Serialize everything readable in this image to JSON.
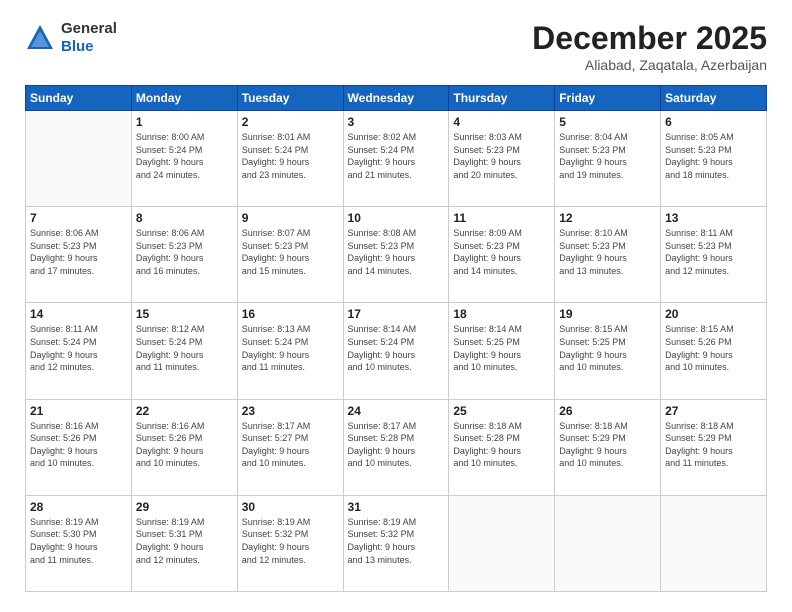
{
  "logo": {
    "general": "General",
    "blue": "Blue"
  },
  "header": {
    "month": "December 2025",
    "location": "Aliabad, Zaqatala, Azerbaijan"
  },
  "weekdays": [
    "Sunday",
    "Monday",
    "Tuesday",
    "Wednesday",
    "Thursday",
    "Friday",
    "Saturday"
  ],
  "weeks": [
    [
      {
        "day": "",
        "info": ""
      },
      {
        "day": "1",
        "info": "Sunrise: 8:00 AM\nSunset: 5:24 PM\nDaylight: 9 hours\nand 24 minutes."
      },
      {
        "day": "2",
        "info": "Sunrise: 8:01 AM\nSunset: 5:24 PM\nDaylight: 9 hours\nand 23 minutes."
      },
      {
        "day": "3",
        "info": "Sunrise: 8:02 AM\nSunset: 5:24 PM\nDaylight: 9 hours\nand 21 minutes."
      },
      {
        "day": "4",
        "info": "Sunrise: 8:03 AM\nSunset: 5:23 PM\nDaylight: 9 hours\nand 20 minutes."
      },
      {
        "day": "5",
        "info": "Sunrise: 8:04 AM\nSunset: 5:23 PM\nDaylight: 9 hours\nand 19 minutes."
      },
      {
        "day": "6",
        "info": "Sunrise: 8:05 AM\nSunset: 5:23 PM\nDaylight: 9 hours\nand 18 minutes."
      }
    ],
    [
      {
        "day": "7",
        "info": "Sunrise: 8:06 AM\nSunset: 5:23 PM\nDaylight: 9 hours\nand 17 minutes."
      },
      {
        "day": "8",
        "info": "Sunrise: 8:06 AM\nSunset: 5:23 PM\nDaylight: 9 hours\nand 16 minutes."
      },
      {
        "day": "9",
        "info": "Sunrise: 8:07 AM\nSunset: 5:23 PM\nDaylight: 9 hours\nand 15 minutes."
      },
      {
        "day": "10",
        "info": "Sunrise: 8:08 AM\nSunset: 5:23 PM\nDaylight: 9 hours\nand 14 minutes."
      },
      {
        "day": "11",
        "info": "Sunrise: 8:09 AM\nSunset: 5:23 PM\nDaylight: 9 hours\nand 14 minutes."
      },
      {
        "day": "12",
        "info": "Sunrise: 8:10 AM\nSunset: 5:23 PM\nDaylight: 9 hours\nand 13 minutes."
      },
      {
        "day": "13",
        "info": "Sunrise: 8:11 AM\nSunset: 5:23 PM\nDaylight: 9 hours\nand 12 minutes."
      }
    ],
    [
      {
        "day": "14",
        "info": "Sunrise: 8:11 AM\nSunset: 5:24 PM\nDaylight: 9 hours\nand 12 minutes."
      },
      {
        "day": "15",
        "info": "Sunrise: 8:12 AM\nSunset: 5:24 PM\nDaylight: 9 hours\nand 11 minutes."
      },
      {
        "day": "16",
        "info": "Sunrise: 8:13 AM\nSunset: 5:24 PM\nDaylight: 9 hours\nand 11 minutes."
      },
      {
        "day": "17",
        "info": "Sunrise: 8:14 AM\nSunset: 5:24 PM\nDaylight: 9 hours\nand 10 minutes."
      },
      {
        "day": "18",
        "info": "Sunrise: 8:14 AM\nSunset: 5:25 PM\nDaylight: 9 hours\nand 10 minutes."
      },
      {
        "day": "19",
        "info": "Sunrise: 8:15 AM\nSunset: 5:25 PM\nDaylight: 9 hours\nand 10 minutes."
      },
      {
        "day": "20",
        "info": "Sunrise: 8:15 AM\nSunset: 5:26 PM\nDaylight: 9 hours\nand 10 minutes."
      }
    ],
    [
      {
        "day": "21",
        "info": "Sunrise: 8:16 AM\nSunset: 5:26 PM\nDaylight: 9 hours\nand 10 minutes."
      },
      {
        "day": "22",
        "info": "Sunrise: 8:16 AM\nSunset: 5:26 PM\nDaylight: 9 hours\nand 10 minutes."
      },
      {
        "day": "23",
        "info": "Sunrise: 8:17 AM\nSunset: 5:27 PM\nDaylight: 9 hours\nand 10 minutes."
      },
      {
        "day": "24",
        "info": "Sunrise: 8:17 AM\nSunset: 5:28 PM\nDaylight: 9 hours\nand 10 minutes."
      },
      {
        "day": "25",
        "info": "Sunrise: 8:18 AM\nSunset: 5:28 PM\nDaylight: 9 hours\nand 10 minutes."
      },
      {
        "day": "26",
        "info": "Sunrise: 8:18 AM\nSunset: 5:29 PM\nDaylight: 9 hours\nand 10 minutes."
      },
      {
        "day": "27",
        "info": "Sunrise: 8:18 AM\nSunset: 5:29 PM\nDaylight: 9 hours\nand 11 minutes."
      }
    ],
    [
      {
        "day": "28",
        "info": "Sunrise: 8:19 AM\nSunset: 5:30 PM\nDaylight: 9 hours\nand 11 minutes."
      },
      {
        "day": "29",
        "info": "Sunrise: 8:19 AM\nSunset: 5:31 PM\nDaylight: 9 hours\nand 12 minutes."
      },
      {
        "day": "30",
        "info": "Sunrise: 8:19 AM\nSunset: 5:32 PM\nDaylight: 9 hours\nand 12 minutes."
      },
      {
        "day": "31",
        "info": "Sunrise: 8:19 AM\nSunset: 5:32 PM\nDaylight: 9 hours\nand 13 minutes."
      },
      {
        "day": "",
        "info": ""
      },
      {
        "day": "",
        "info": ""
      },
      {
        "day": "",
        "info": ""
      }
    ]
  ]
}
